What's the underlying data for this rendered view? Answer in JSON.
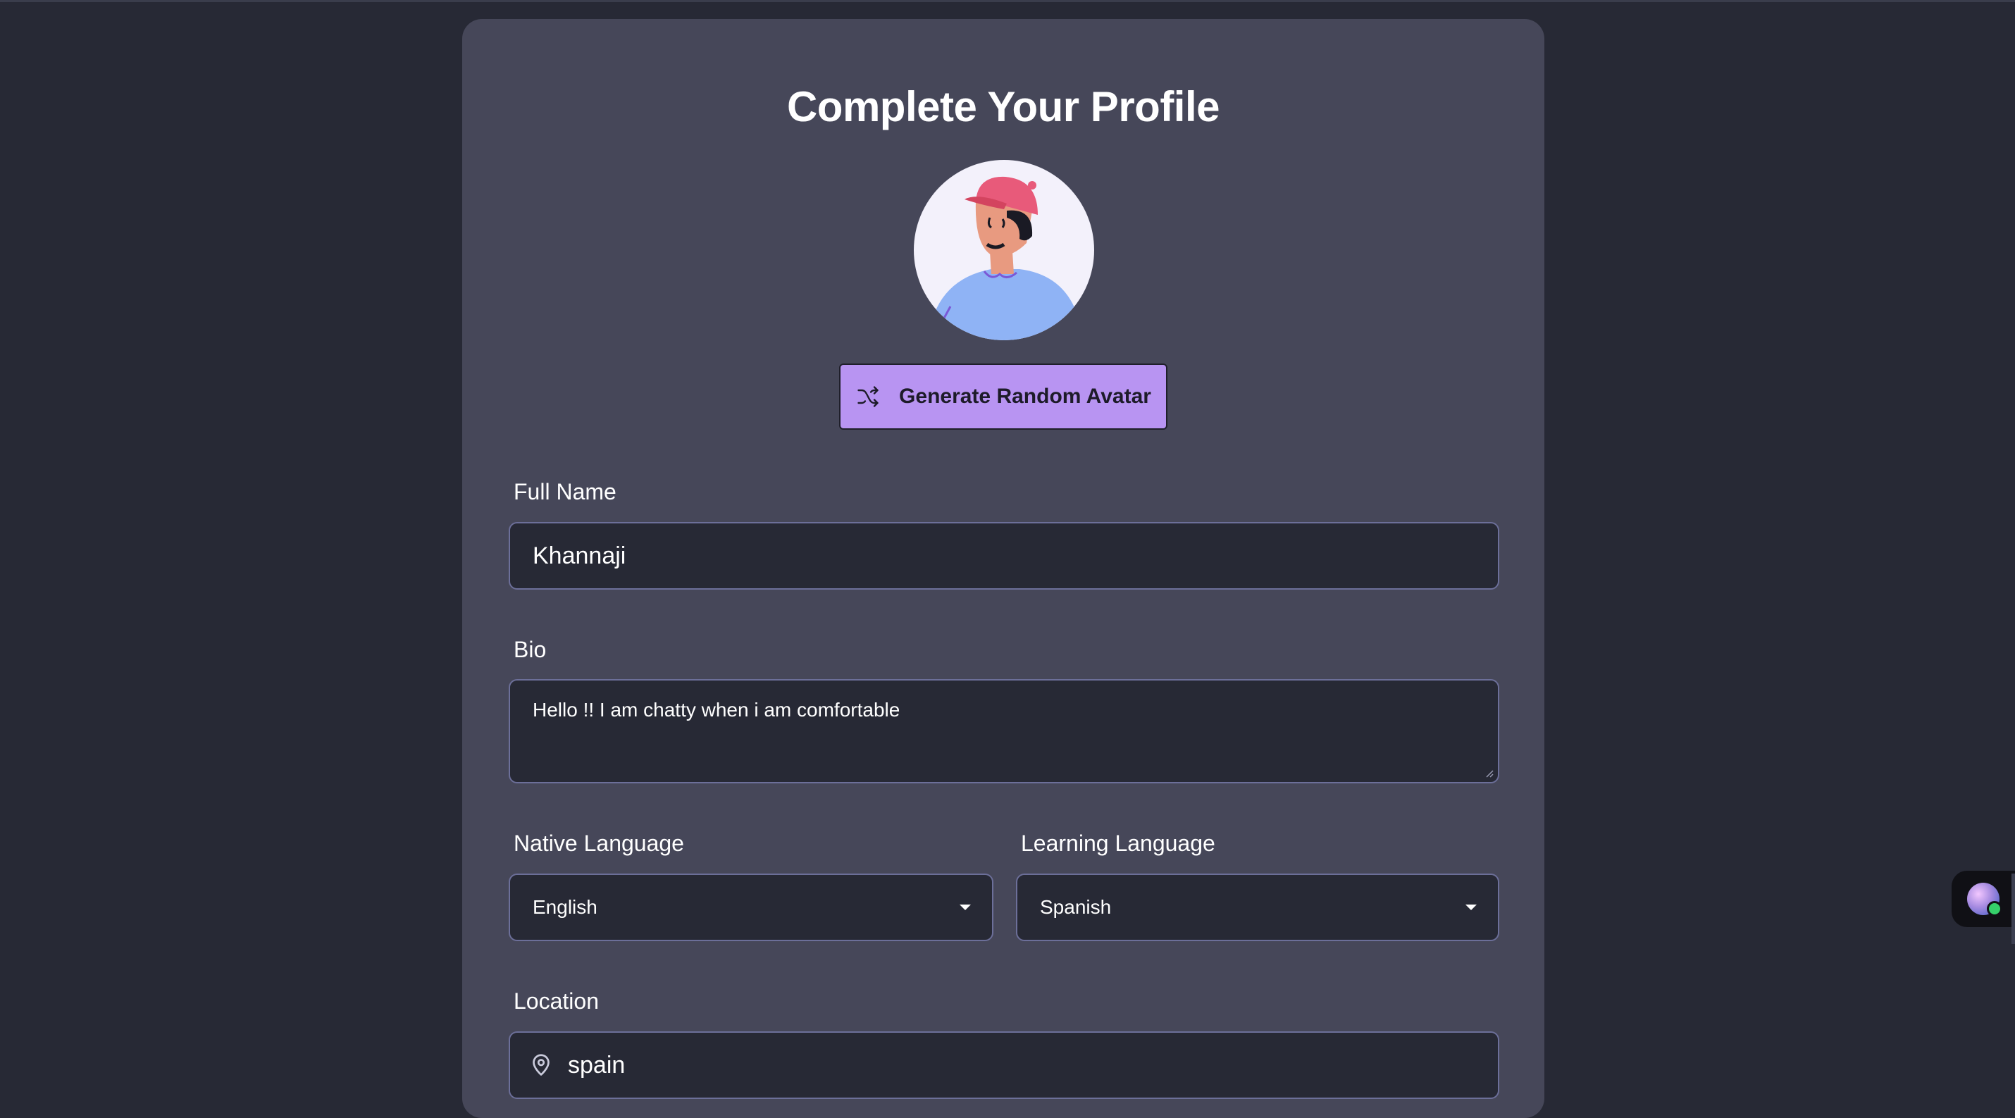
{
  "page": {
    "title": "Complete Your Profile"
  },
  "avatar": {
    "icon": "avatar-illustration",
    "generate_label": "Generate Random Avatar",
    "generate_icon": "shuffle-icon"
  },
  "form": {
    "full_name": {
      "label": "Full Name",
      "value": "Khannaji"
    },
    "bio": {
      "label": "Bio",
      "value": "Hello !! I am chatty when i am comfortable"
    },
    "native_language": {
      "label": "Native Language",
      "value": "English"
    },
    "learning_language": {
      "label": "Learning Language",
      "value": "Spanish"
    },
    "location": {
      "label": "Location",
      "value": "spain",
      "icon": "map-pin-icon"
    }
  },
  "colors": {
    "background": "#272935",
    "card": "#464759",
    "accent_button": "#b894f2",
    "field_border": "#6c6f99"
  }
}
